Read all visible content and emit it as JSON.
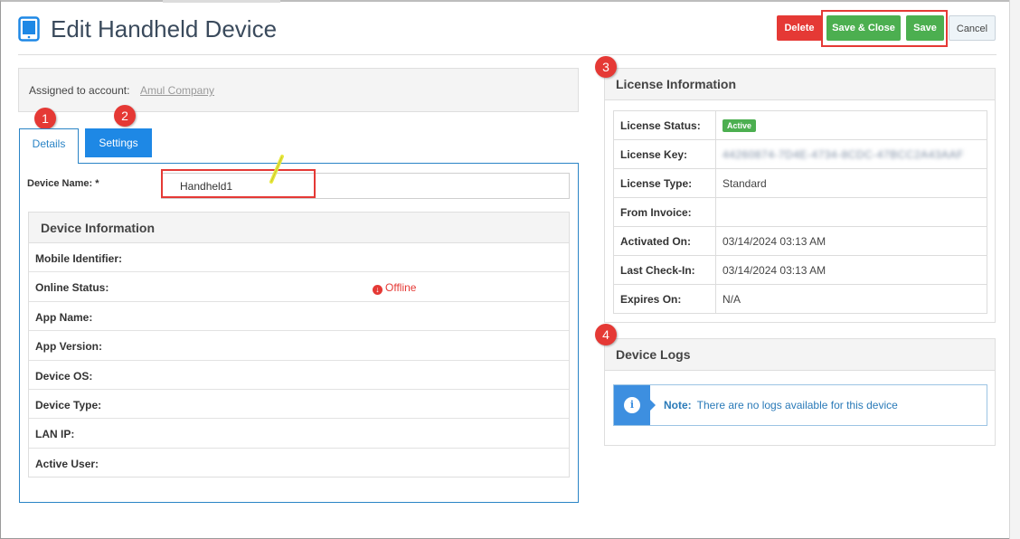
{
  "page": {
    "title": "Edit Handheld Device"
  },
  "actions": {
    "delete": "Delete",
    "save_close": "Save & Close",
    "save": "Save",
    "cancel": "Cancel"
  },
  "assigned": {
    "label": "Assigned to account:",
    "account": "Amul Company"
  },
  "badges": [
    "1",
    "2",
    "3",
    "4"
  ],
  "tabs": [
    {
      "label": "Details",
      "active": true
    },
    {
      "label": "Settings",
      "active": false
    }
  ],
  "device_name": {
    "label": "Device Name: *",
    "value": "Handheld1"
  },
  "device_info": {
    "title": "Device Information",
    "rows": [
      {
        "label": "Mobile Identifier:",
        "value": ""
      },
      {
        "label": "Online Status:",
        "value": "Offline"
      },
      {
        "label": "App Name:",
        "value": ""
      },
      {
        "label": "App Version:",
        "value": ""
      },
      {
        "label": "Device OS:",
        "value": ""
      },
      {
        "label": "Device Type:",
        "value": ""
      },
      {
        "label": "LAN IP:",
        "value": ""
      },
      {
        "label": "Active User:",
        "value": ""
      }
    ]
  },
  "license": {
    "title": "License Information",
    "rows": [
      {
        "label": "License Status:",
        "value": "Active"
      },
      {
        "label": "License Key:",
        "value": "44260874-7D4E-4734-8CDC-47BCC2A43AAF"
      },
      {
        "label": "License Type:",
        "value": "Standard"
      },
      {
        "label": "From Invoice:",
        "value": ""
      },
      {
        "label": "Activated On:",
        "value": "03/14/2024 03:13 AM"
      },
      {
        "label": "Last Check-In:",
        "value": "03/14/2024 03:13 AM"
      },
      {
        "label": "Expires On:",
        "value": "N/A"
      }
    ]
  },
  "logs": {
    "title": "Device Logs",
    "note_label": "Note:",
    "note_text": "There are no logs available for this device"
  },
  "colors": {
    "danger": "#e53935",
    "success": "#4caf50",
    "primary": "#1e88e5",
    "info": "#3d8fe0"
  }
}
